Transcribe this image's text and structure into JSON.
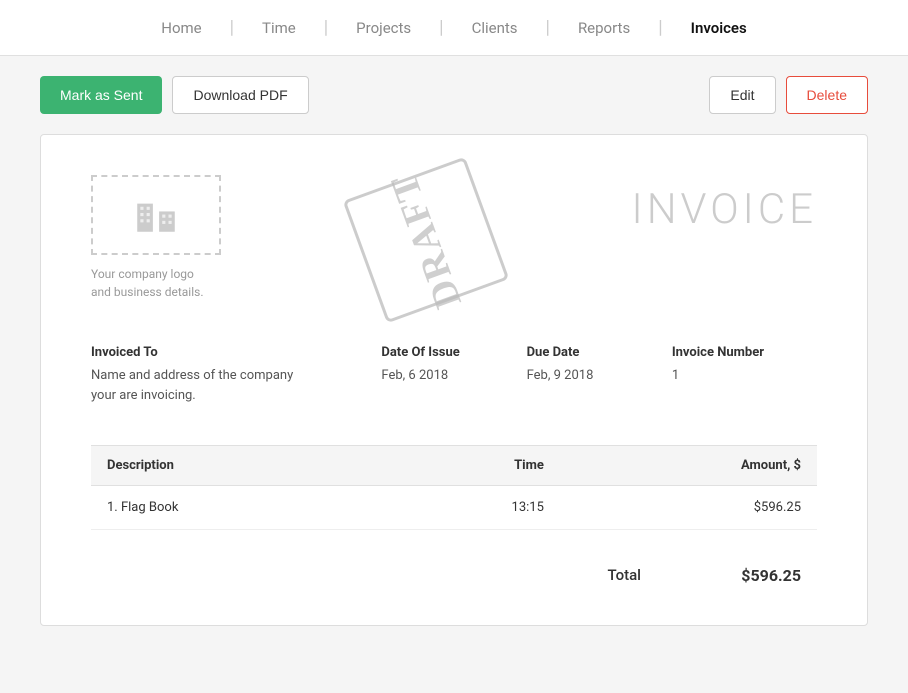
{
  "nav": {
    "items": [
      {
        "label": "Home",
        "active": false
      },
      {
        "label": "Time",
        "active": false
      },
      {
        "label": "Projects",
        "active": false
      },
      {
        "label": "Clients",
        "active": false
      },
      {
        "label": "Reports",
        "active": false
      },
      {
        "label": "Invoices",
        "active": true
      }
    ]
  },
  "toolbar": {
    "mark_as_sent_label": "Mark as Sent",
    "download_pdf_label": "Download PDF",
    "edit_label": "Edit",
    "delete_label": "Delete"
  },
  "invoice": {
    "company_logo_text": "Your company logo\nand business details.",
    "draft_stamp": "DRAFT",
    "invoice_title": "INVOICE",
    "invoiced_to_label": "Invoiced To",
    "invoiced_to_value": "Name and address of the company\nyour are invoicing.",
    "date_of_issue_label": "Date Of Issue",
    "date_of_issue_value": "Feb, 6 2018",
    "due_date_label": "Due Date",
    "due_date_value": "Feb, 9 2018",
    "invoice_number_label": "Invoice Number",
    "invoice_number_value": "1",
    "table": {
      "col_description": "Description",
      "col_time": "Time",
      "col_amount": "Amount, $",
      "rows": [
        {
          "description": "1. Flag Book",
          "time": "13:15",
          "amount": "$596.25"
        }
      ]
    },
    "total_label": "Total",
    "total_value": "$596.25"
  }
}
